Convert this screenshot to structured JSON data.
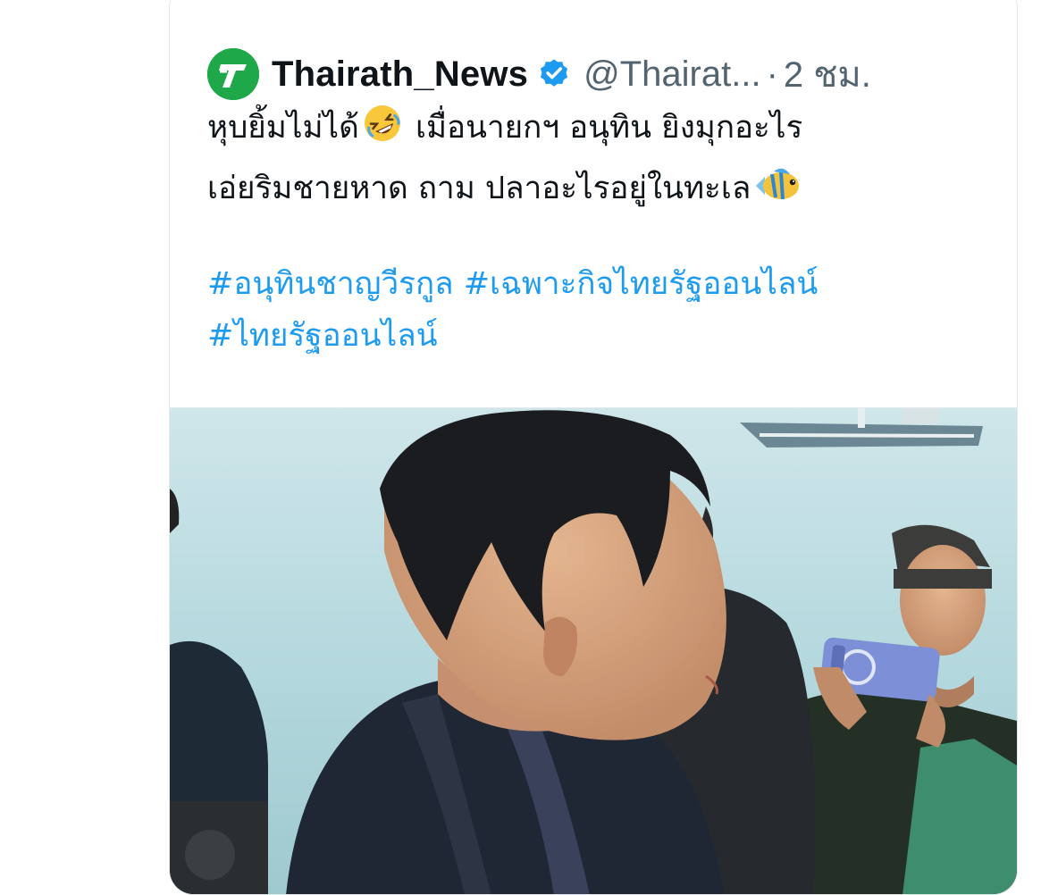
{
  "tweet": {
    "display_name": "Thairath_News",
    "handle": "@Thairat...",
    "separator": "·",
    "time": "2 ชม.",
    "avatar_letter": "T",
    "avatar_color": "#1ea84a",
    "verified_color": "#1d9bf0",
    "text_line1_a": "หุบยิ้มไม่ได้",
    "text_line1_b": " เมื่อนายกฯ อนุทิน ยิงมุกอะไร",
    "text_line2": "เอ่ยริมชายหาด ถาม ปลาอะไรอยู่ในทะเล",
    "emoji_1": "rolling-on-floor-laughing-icon",
    "emoji_2": "tropical-fish-icon",
    "hashtags": [
      "#อนุทินชาญวีรกูล",
      "#เฉพาะกิจไทยรัฐออนไลน์",
      "#ไทยรัฐออนไลน์"
    ],
    "hashtag_color": "#1d9bf0"
  },
  "media": {
    "type": "video-thumbnail"
  }
}
